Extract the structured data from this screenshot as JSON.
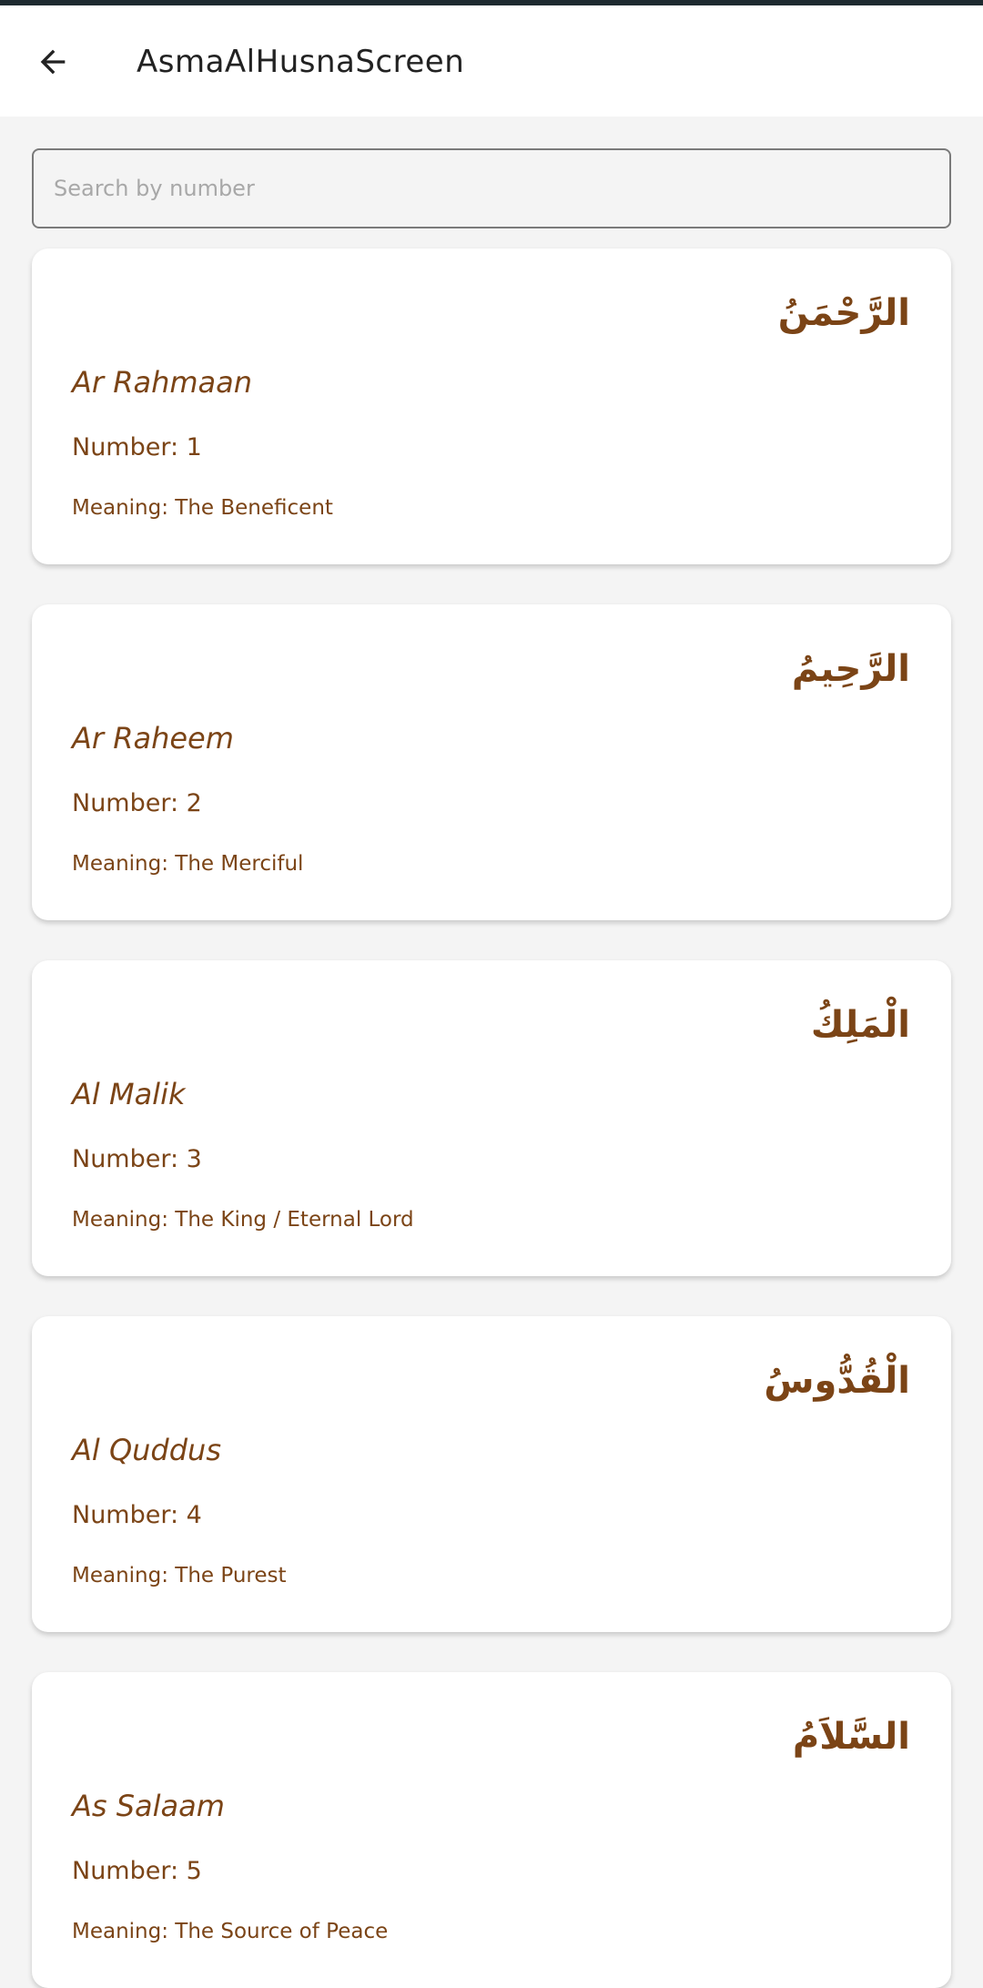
{
  "app_bar": {
    "title": "AsmaAlHusnaScreen",
    "back_icon": "arrow-left-icon"
  },
  "search": {
    "placeholder": "Search by number",
    "value": ""
  },
  "colors": {
    "accent": "#7b4416",
    "background": "#f4f4f4",
    "card": "#ffffff"
  },
  "names": [
    {
      "arabic": "الرَّحْمَنُ",
      "transliteration": "Ar Rahmaan",
      "number": "Number: 1",
      "meaning": "Meaning: The Beneficent"
    },
    {
      "arabic": "الرَّحِيمُ",
      "transliteration": "Ar Raheem",
      "number": "Number: 2",
      "meaning": "Meaning: The Merciful"
    },
    {
      "arabic": "الْمَلِكُ",
      "transliteration": "Al Malik",
      "number": "Number: 3",
      "meaning": "Meaning: The King / Eternal Lord"
    },
    {
      "arabic": "الْقُدُّوسُ",
      "transliteration": "Al Quddus",
      "number": "Number: 4",
      "meaning": "Meaning: The Purest"
    },
    {
      "arabic": "السَّلاَمُ",
      "transliteration": "As Salaam",
      "number": "Number: 5",
      "meaning": "Meaning: The Source of Peace"
    }
  ]
}
